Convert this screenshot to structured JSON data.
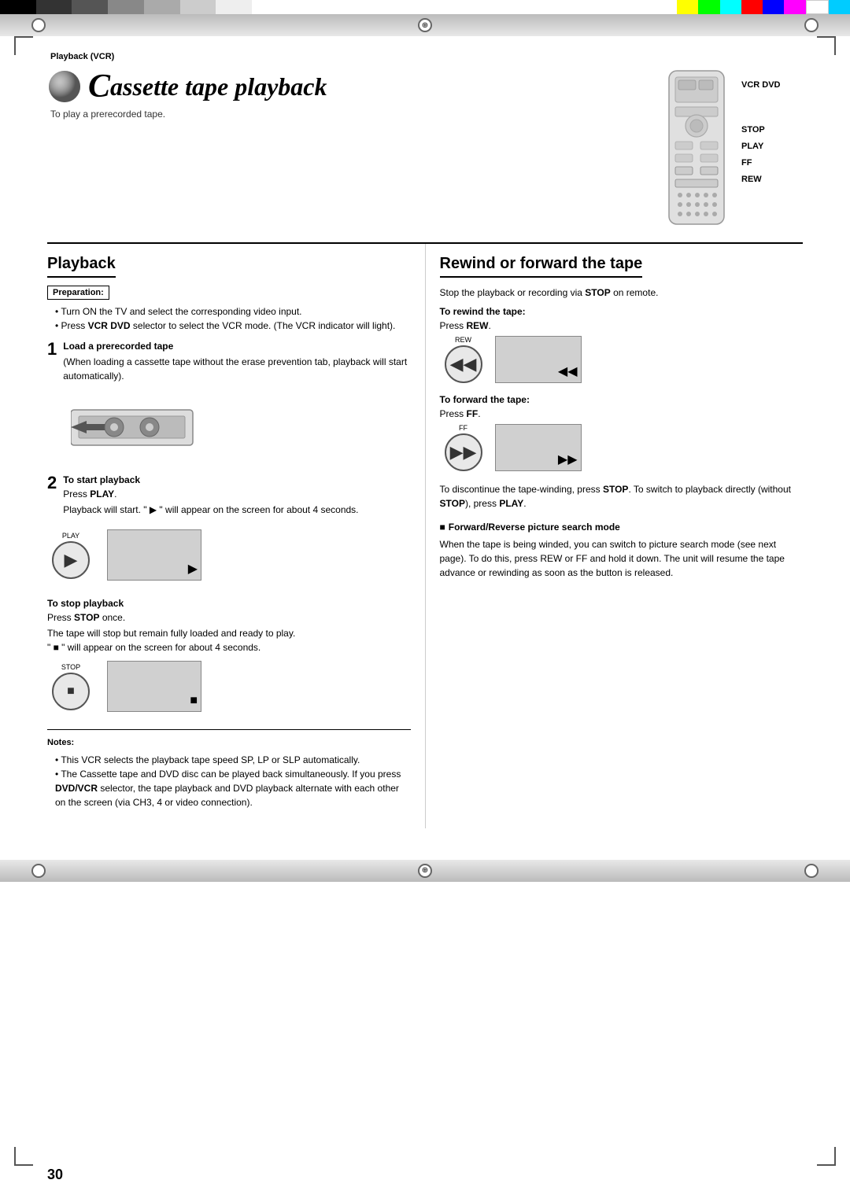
{
  "page": {
    "number": "30",
    "section_label": "Playback (VCR)",
    "top_color_blocks_left": [
      "black",
      "dark",
      "med",
      "light",
      "lighter",
      "lightest",
      "white"
    ],
    "top_color_blocks_right": [
      "yellow",
      "green",
      "cyan",
      "red",
      "blue",
      "magenta",
      "white2",
      "ltblue"
    ]
  },
  "title_section": {
    "title_prefix": "C",
    "title_main": "assette tape playback",
    "subtitle": "To play a prerecorded tape.",
    "remote_labels": [
      "VCR DVD",
      "STOP",
      "PLAY",
      "FF",
      "REW"
    ]
  },
  "playback_section": {
    "heading": "Playback",
    "preparation_label": "Preparation:",
    "preparation_bullets": [
      "Turn ON the TV and select the corresponding video input.",
      "Press VCR DVD selector to select the VCR mode. (The VCR indicator will light)."
    ],
    "step1": {
      "number": "1",
      "title": "Load a prerecorded tape",
      "description": "(When loading a cassette tape without the erase prevention tab, playback will start automatically)."
    },
    "step2": {
      "number": "2",
      "title": "To start playback",
      "press_label": "Press",
      "press_button": "PLAY",
      "description": "Playback will start. \" ▶ \" will appear on the screen for about 4 seconds.",
      "button_label": "PLAY",
      "screen_symbol": "▶"
    },
    "step3": {
      "title": "To stop playback",
      "press_label": "Press",
      "press_button": "STOP",
      "description_parts": [
        "The tape will stop but remain fully loaded and ready to play.",
        "\" ■ \" will appear on the screen for about 4 seconds."
      ],
      "button_label": "STOP",
      "screen_symbol": "■"
    },
    "notes": {
      "title": "Notes:",
      "bullets": [
        "This VCR selects the playback tape speed SP, LP or SLP automatically.",
        "The Cassette tape and DVD disc can be played back simultaneously. If you press DVD/VCR selector, the tape playback and DVD playback alternate with each other on the screen (via CH3, 4 or video connection)."
      ]
    }
  },
  "rewind_section": {
    "heading": "Rewind or forward the tape",
    "intro": "Stop the playback or recording via STOP on remote.",
    "rewind": {
      "title": "To rewind the tape:",
      "press_label": "Press",
      "press_button": "REW",
      "button_label": "REW",
      "screen_symbol": "◀◀"
    },
    "forward": {
      "title": "To forward the tape:",
      "press_label": "Press",
      "press_button": "FF",
      "button_label": "FF",
      "screen_symbol": "▶▶"
    },
    "discontinue_text": "To discontinue the tape-winding, press STOP. To switch to playback directly (without STOP), press PLAY.",
    "forward_reverse": {
      "title": "Forward/Reverse picture search mode",
      "description": "When the tape is being winded, you can switch to picture search mode (see next page). To do this, press REW or FF and hold it down. The unit will resume the tape advance or rewinding as soon as the button is released."
    }
  }
}
